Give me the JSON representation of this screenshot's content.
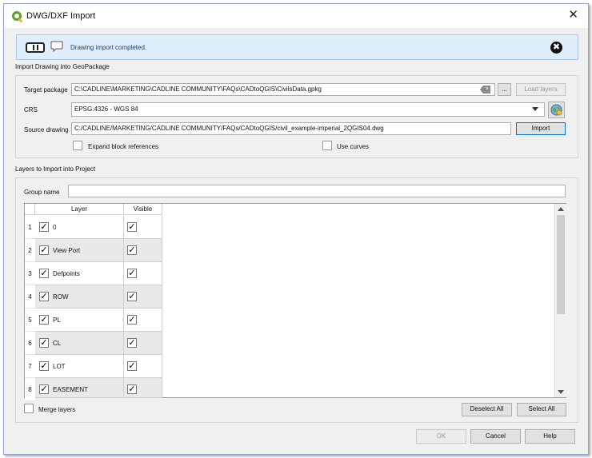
{
  "window": {
    "title": "DWG/DXF Import",
    "close_glyph": "✕"
  },
  "message_bar": {
    "text": "Drawing import completed.",
    "close_glyph": "✖"
  },
  "import_section": {
    "label": "Import Drawing into GeoPackage",
    "target_label": "Target package",
    "target_value": "C:\\CADLINE\\MARKETING\\CADLINE COMMUNITY\\FAQs\\CADtoQGIS\\CivilsData.gpkg",
    "browse_label": "...",
    "load_layers_label": "Load layers",
    "crs_label": "CRS",
    "crs_value": "EPSG:4326 - WGS 84",
    "source_label": "Source drawing",
    "source_value": "C:/CADLINE/MARKETING/CADLINE COMMUNITY/FAQs/CADtoQGIS/civil_example-imperial_2QGIS04.dwg",
    "import_label": "Import",
    "expand_label": "Expand block references",
    "curves_label": "Use curves"
  },
  "layers_section": {
    "label": "Layers to Import into Project",
    "group_label": "Group name",
    "group_value": "",
    "col_layer": "Layer",
    "col_visible": "Visible",
    "rows": [
      {
        "num": "1",
        "name": "0",
        "checked": "✓",
        "visible": "✓"
      },
      {
        "num": "2",
        "name": "View Port",
        "checked": "✓",
        "visible": "✓"
      },
      {
        "num": "3",
        "name": "Defpoints",
        "checked": "✓",
        "visible": "✓"
      },
      {
        "num": "4",
        "name": "ROW",
        "checked": "✓",
        "visible": "✓"
      },
      {
        "num": "5",
        "name": "PL",
        "checked": "✓",
        "visible": "✓"
      },
      {
        "num": "6",
        "name": "CL",
        "checked": "✓",
        "visible": "✓"
      },
      {
        "num": "7",
        "name": "LOT",
        "checked": "✓",
        "visible": "✓"
      },
      {
        "num": "8",
        "name": "EASEMENT",
        "checked": "✓",
        "visible": "✓"
      }
    ],
    "merge_label": "Merge layers",
    "deselect_label": "Deselect All",
    "select_label": "Select All"
  },
  "footer": {
    "ok_label": "OK",
    "cancel_label": "Cancel",
    "help_label": "Help"
  },
  "colors": {
    "message_bg": "#dfeefa",
    "message_text": "#1a3f7a",
    "accent": "#0078d7"
  },
  "icons": [
    "qgis-logo-icon",
    "pause-icon",
    "message-bubble-icon",
    "close-circle-icon",
    "clear-text-icon",
    "dropdown-arrow-icon",
    "globe-crs-icon",
    "checkmark-icon"
  ]
}
